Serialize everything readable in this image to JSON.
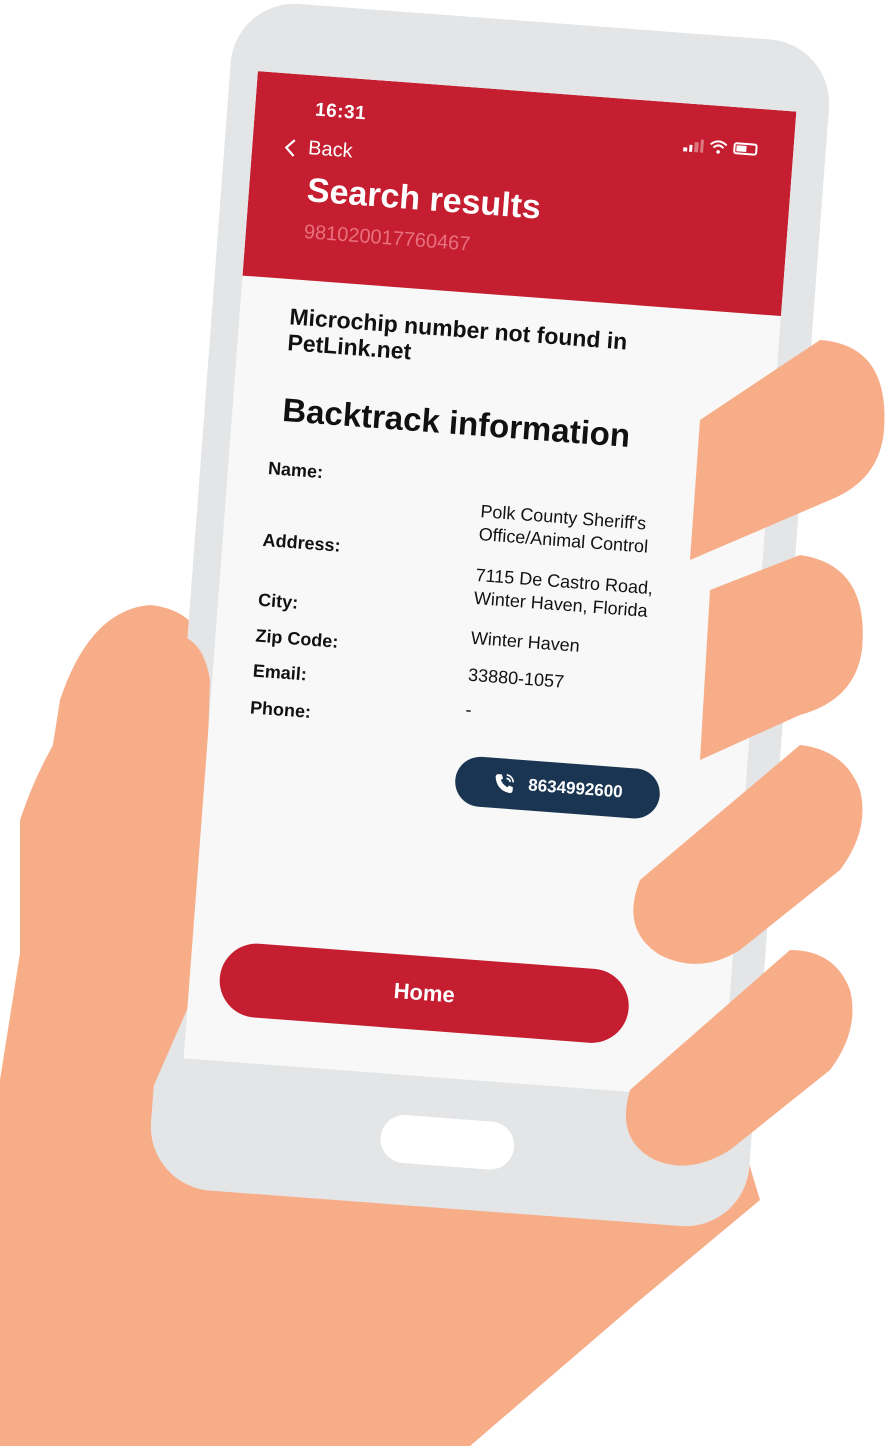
{
  "status_bar": {
    "time": "16:31"
  },
  "nav": {
    "back_label": "Back"
  },
  "header": {
    "title": "Search results",
    "subtitle": "981020017760467"
  },
  "message": "Microchip number not found in PetLink.net",
  "section_title": "Backtrack information",
  "fields": {
    "name_label": "Name:",
    "name_value_line1": "Polk County Sheriff's",
    "name_value_line2": "Office/Animal Control",
    "address_label": "Address:",
    "address_value_line1": "7115 De Castro Road,",
    "address_value_line2": "Winter Haven, Florida",
    "city_label": "City:",
    "city_value": "Winter Haven",
    "zip_label": "Zip Code:",
    "zip_value": "33880-1057",
    "email_label": "Email:",
    "email_value": "-",
    "phone_label": "Phone:",
    "phone_value": "8634992600"
  },
  "footer": {
    "home_label": "Home"
  },
  "colors": {
    "brand_red": "#c41e30",
    "navy": "#1a3552",
    "skin": "#f8ad89",
    "phone_frame": "#e4e5e6"
  }
}
